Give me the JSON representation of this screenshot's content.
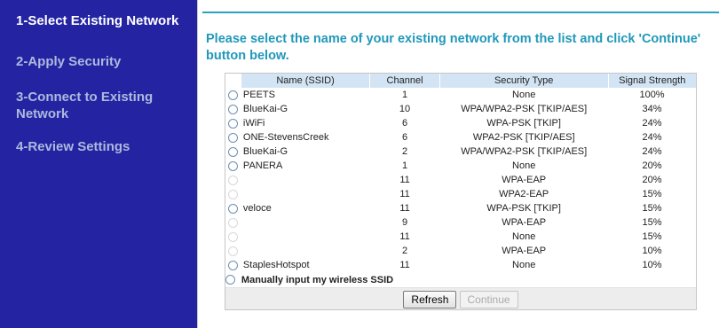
{
  "sidebar": {
    "steps": [
      {
        "label": "1-Select Existing Network"
      },
      {
        "label": "2-Apply Security"
      },
      {
        "label": "3-Connect to Existing Network"
      },
      {
        "label": "4-Review Settings"
      }
    ]
  },
  "main": {
    "intro": "Please select the name of your existing network from the list and click 'Continue' button below."
  },
  "table": {
    "headers": [
      "Name (SSID)",
      "Channel",
      "Security Type",
      "Signal Strength"
    ],
    "rows": [
      {
        "ssid": "PEETS",
        "channel": "1",
        "security": "None",
        "signal": "100%"
      },
      {
        "ssid": "BlueKai-G",
        "channel": "10",
        "security": "WPA/WPA2-PSK [TKIP/AES]",
        "signal": "34%"
      },
      {
        "ssid": "iWiFi",
        "channel": "6",
        "security": "WPA-PSK [TKIP]",
        "signal": "24%"
      },
      {
        "ssid": "ONE-StevensCreek",
        "channel": "6",
        "security": "WPA2-PSK [TKIP/AES]",
        "signal": "24%"
      },
      {
        "ssid": "BlueKai-G",
        "channel": "2",
        "security": "WPA/WPA2-PSK [TKIP/AES]",
        "signal": "24%"
      },
      {
        "ssid": "PANERA",
        "channel": "1",
        "security": "None",
        "signal": "20%"
      },
      {
        "ssid": "",
        "channel": "11",
        "security": "WPA-EAP",
        "signal": "20%"
      },
      {
        "ssid": "",
        "channel": "11",
        "security": "WPA2-EAP",
        "signal": "15%"
      },
      {
        "ssid": "veloce",
        "channel": "11",
        "security": "WPA-PSK [TKIP]",
        "signal": "15%"
      },
      {
        "ssid": "",
        "channel": "9",
        "security": "WPA-EAP",
        "signal": "15%"
      },
      {
        "ssid": "",
        "channel": "11",
        "security": "None",
        "signal": "15%"
      },
      {
        "ssid": "",
        "channel": "2",
        "security": "WPA-EAP",
        "signal": "10%"
      },
      {
        "ssid": "StaplesHotspot",
        "channel": "11",
        "security": "None",
        "signal": "10%"
      }
    ],
    "manual_label": "Manually input my wireless SSID"
  },
  "buttons": {
    "refresh": "Refresh",
    "continue": "Continue"
  },
  "colors": {
    "sidebar_bg": "#2424a3",
    "sidebar_active": "#ffffff",
    "sidebar_inactive": "#aeb9dc",
    "accent": "#2098ba",
    "header_bg": "#d3e4f4"
  }
}
